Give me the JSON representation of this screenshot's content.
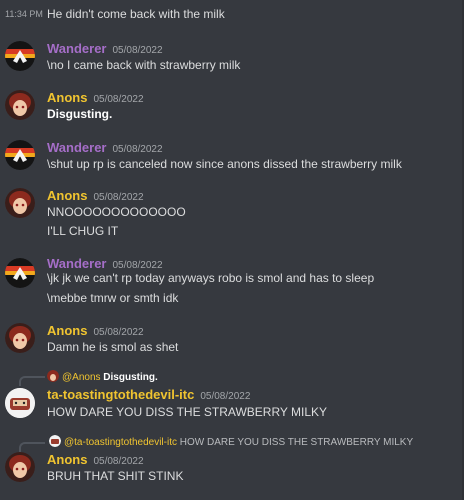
{
  "colors": {
    "background": "#36393f",
    "wanderer": "#a56ec8",
    "anons": "#f0c430",
    "toasting": "#f0c430",
    "text": "#dcddde",
    "muted": "#a3a6aa"
  },
  "messages": [
    {
      "time": "11:34 PM",
      "text": "He didn't come back with the milk"
    },
    {
      "user": "Wanderer",
      "date": "05/08/2022",
      "lines": [
        "\\no I came back with strawberry milk"
      ]
    },
    {
      "user": "Anons",
      "date": "05/08/2022",
      "lines": [
        "Disgusting."
      ]
    },
    {
      "user": "Wanderer",
      "date": "05/08/2022",
      "lines": [
        "\\shut up rp is canceled now since anons dissed the strawberry milk"
      ]
    },
    {
      "user": "Anons",
      "date": "05/08/2022",
      "lines": [
        "NNOOOOOOOOOOOOO",
        "I'LL CHUG IT"
      ]
    },
    {
      "user": "Wanderer",
      "date": "05/08/2022",
      "lines": [
        "\\jk jk we can't rp today anyways robo is smol and has to sleep",
        "\\mebbe tmrw or smth idk"
      ]
    },
    {
      "user": "Anons",
      "date": "05/08/2022",
      "lines": [
        "Damn he is smol as shet"
      ]
    },
    {
      "reply_to": "@Anons",
      "reply_text": "Disgusting.",
      "user": "ta-toastingtothedevil-itc",
      "date": "05/08/2022",
      "lines": [
        "HOW DARE YOU DISS THE STRAWBERRY MILKY"
      ]
    },
    {
      "reply_to": "@ta-toastingtothedevil-itc",
      "reply_text": "HOW DARE YOU DISS THE STRAWBERRY MILKY",
      "user": "Anons",
      "date": "05/08/2022",
      "lines": [
        "BRUH THAT SHIT STINK"
      ]
    }
  ]
}
